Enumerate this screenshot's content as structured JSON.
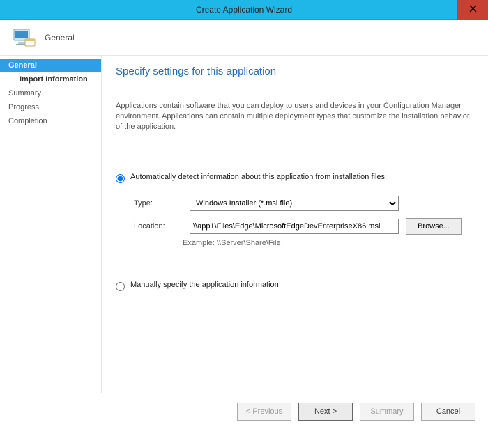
{
  "window": {
    "title": "Create Application Wizard"
  },
  "header": {
    "page_label": "General"
  },
  "sidebar": {
    "items": [
      {
        "label": "General"
      },
      {
        "label": "Import Information"
      },
      {
        "label": "Summary"
      },
      {
        "label": "Progress"
      },
      {
        "label": "Completion"
      }
    ]
  },
  "main": {
    "heading": "Specify settings for this application",
    "intro": "Applications contain software that you can deploy to users and devices in your Configuration Manager environment. Applications can contain multiple deployment types that customize the installation behavior of the application.",
    "auto_detect_label": "Automatically detect information about this application from installation files:",
    "type_label": "Type:",
    "type_value": "Windows Installer (*.msi file)",
    "location_label": "Location:",
    "location_value": "\\\\app1\\Files\\Edge\\MicrosoftEdgeDevEnterpriseX86.msi",
    "browse_label": "Browse...",
    "example_label": "Example: \\\\Server\\Share\\File",
    "manual_label": "Manually specify the application information"
  },
  "footer": {
    "previous": "< Previous",
    "next": "Next >",
    "summary": "Summary",
    "cancel": "Cancel"
  }
}
